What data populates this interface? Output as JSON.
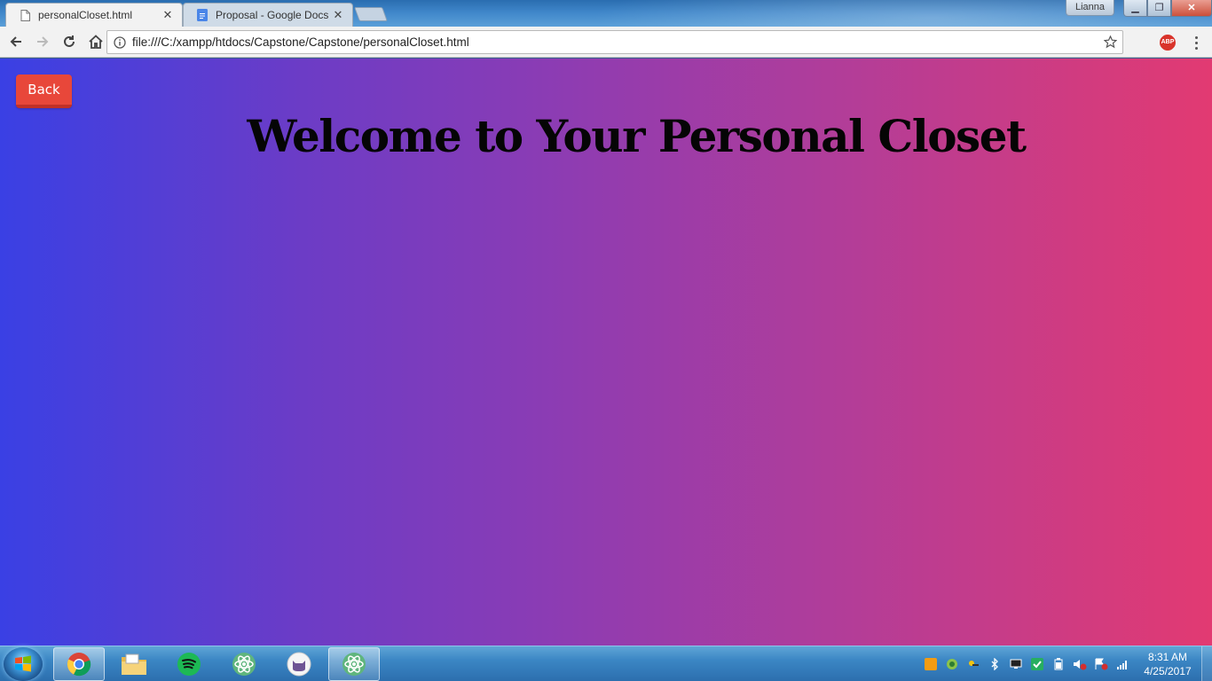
{
  "browser": {
    "tabs": [
      {
        "title": "personalCloset.html",
        "close": "✕"
      },
      {
        "title": "Proposal - Google Docs",
        "close": "✕"
      }
    ],
    "user_badge": "Lianna",
    "window_controls": {
      "minimize": "▁",
      "maximize": "❐",
      "close": "✕"
    },
    "address_bar": {
      "url": "file:///C:/xampp/htdocs/Capstone/Capstone/personalCloset.html"
    },
    "extensions": {
      "adblock": "ABP"
    }
  },
  "page": {
    "back_button": "Back",
    "title": "Welcome to Your Personal Closet",
    "gradient": {
      "start": "#3a40e4",
      "end": "#e23a72"
    },
    "button_color": "#e8473a"
  },
  "taskbar": {
    "pinned": [
      {
        "name": "chrome-icon",
        "active": true
      },
      {
        "name": "file-explorer-icon",
        "active": false
      },
      {
        "name": "spotify-icon",
        "active": false
      },
      {
        "name": "atom-icon",
        "active": false
      },
      {
        "name": "github-desktop-icon",
        "active": false
      },
      {
        "name": "atom-icon",
        "active": true
      }
    ],
    "clock": {
      "time": "8:31 AM",
      "date": "4/25/2017"
    }
  }
}
